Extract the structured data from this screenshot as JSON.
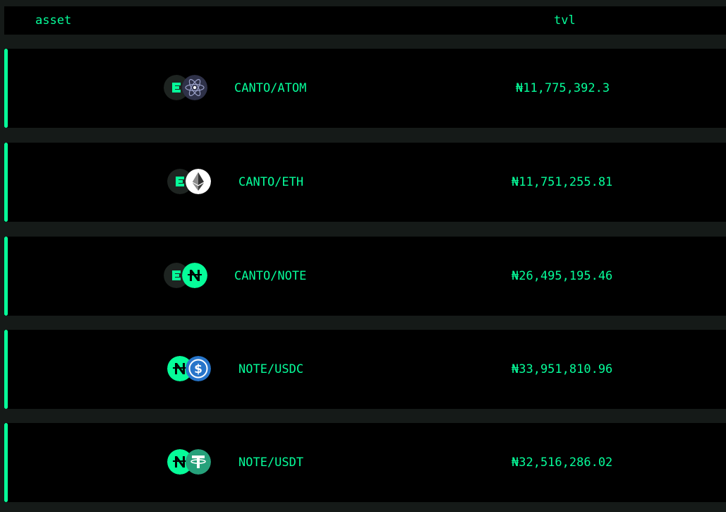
{
  "table": {
    "headers": {
      "asset": "asset",
      "tvl": "tvl"
    },
    "rows": [
      {
        "pair": "CANTO/ATOM",
        "tvl": "₦11,775,392.3",
        "icons": [
          "canto-icon",
          "atom-icon"
        ]
      },
      {
        "pair": "CANTO/ETH",
        "tvl": "₦11,751,255.81",
        "icons": [
          "canto-icon",
          "eth-icon"
        ]
      },
      {
        "pair": "CANTO/NOTE",
        "tvl": "₦26,495,195.46",
        "icons": [
          "canto-icon",
          "note-icon"
        ]
      },
      {
        "pair": "NOTE/USDC",
        "tvl": "₦33,951,810.96",
        "icons": [
          "note-icon",
          "usdc-icon"
        ]
      },
      {
        "pair": "NOTE/USDT",
        "tvl": "₦32,516,286.02",
        "icons": [
          "note-icon",
          "usdt-icon"
        ]
      }
    ]
  },
  "colors": {
    "accent": "#06fc99",
    "row_bg": "#000000",
    "page_bg": "#151a18",
    "atom": "#2e3148",
    "eth_bg": "#ffffff",
    "usdc": "#2775ca",
    "usdt": "#26a17b"
  }
}
